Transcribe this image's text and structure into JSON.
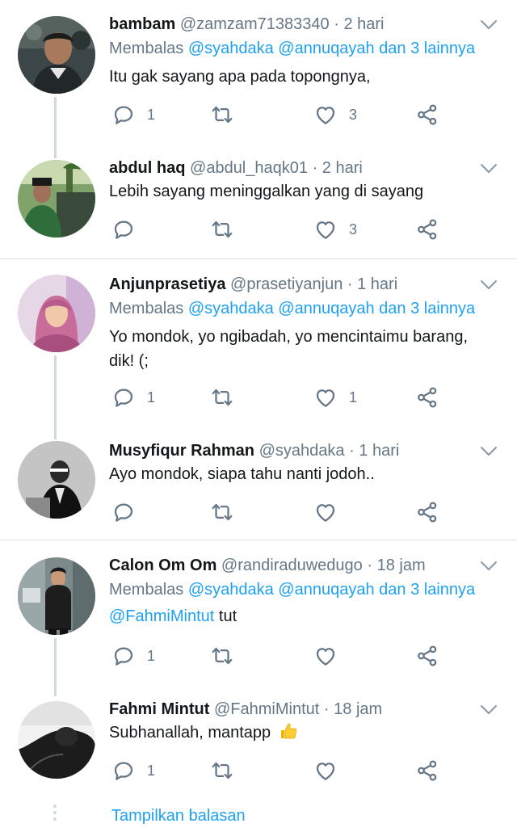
{
  "colors": {
    "link": "#1da1f2",
    "muted": "#657786",
    "text": "#14171a",
    "thread_line": "#cfd9de"
  },
  "icons": {
    "reply": "reply-icon",
    "retweet": "retweet-icon",
    "like": "heart-icon",
    "share": "share-icon",
    "more": "chevron-down-icon"
  },
  "tweets": [
    {
      "name": "bambam",
      "handle": "@zamzam71383340",
      "dot": "·",
      "time": "2 hari",
      "reply_prefix": "Membalas",
      "reply_to": "@syahdaka @annuqayah dan 3 lainnya",
      "text": "Itu gak sayang apa pada topongnya,",
      "reply_count": "1",
      "like_count": "3"
    },
    {
      "name": "abdul haq",
      "handle": "@abdul_haqk01",
      "dot": "·",
      "time": "2 hari",
      "text": "Lebih sayang meninggalkan yang di sayang",
      "reply_count": "",
      "like_count": "3"
    },
    {
      "name": "Anjunprasetiya",
      "handle": "@prasetiyanjun",
      "dot": "·",
      "time": "1 hari",
      "reply_prefix": "Membalas",
      "reply_to": "@syahdaka @annuqayah dan 3 lainnya",
      "text": "Yo mondok, yo ngibadah, yo mencintaimu barang, dik! (;",
      "reply_count": "1",
      "like_count": "1"
    },
    {
      "name": "Musyfiqur Rahman",
      "handle": "@syahdaka",
      "dot": "·",
      "time": "1 hari",
      "text": "Ayo mondok, siapa tahu nanti jodoh..",
      "reply_count": "",
      "like_count": ""
    },
    {
      "name": "Calon Om Om",
      "handle": "@randiraduwedugo",
      "dot": "·",
      "time": "18 jam",
      "reply_prefix": "Membalas",
      "reply_to": "@syahdaka @annuqayah dan 3 lainnya",
      "text_mention": "@FahmiMintut",
      "text": "tut",
      "reply_count": "1",
      "like_count": ""
    },
    {
      "name": "Fahmi Mintut",
      "handle": "@FahmiMintut",
      "dot": "·",
      "time": "18 jam",
      "text": "Subhanallah, mantapp",
      "reply_count": "1",
      "like_count": ""
    }
  ],
  "show_replies": "Tampilkan balasan"
}
